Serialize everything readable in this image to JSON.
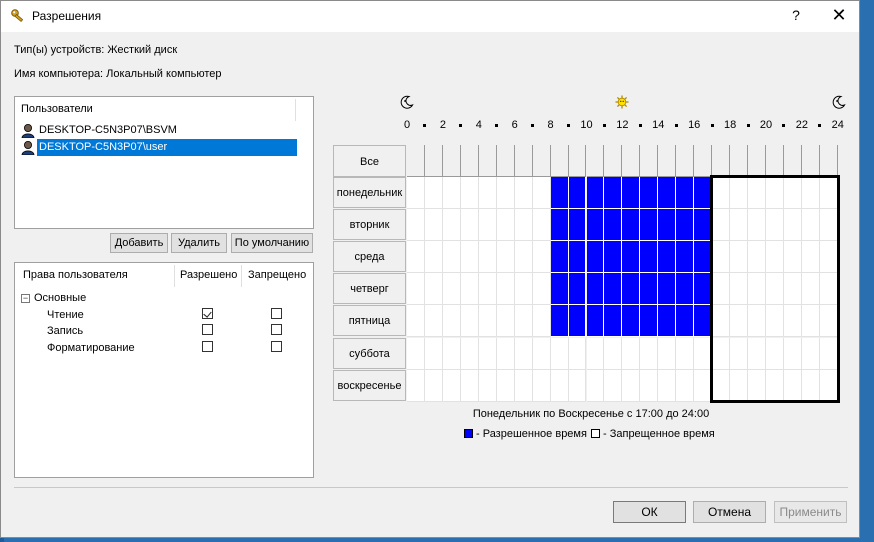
{
  "window": {
    "title": "Разрешения",
    "help": "?",
    "close": "✕"
  },
  "info": {
    "device_line": "Тип(ы) устройств: Жесткий диск",
    "computer_line": "Имя компьютера: Локальный компьютер"
  },
  "users": {
    "header": "Пользователи",
    "items": [
      {
        "name": "DESKTOP-C5N3P07\\BSVM",
        "selected": false
      },
      {
        "name": "DESKTOP-C5N3P07\\user",
        "selected": true
      }
    ]
  },
  "user_buttons": {
    "add": "Добавить",
    "delete": "Удалить",
    "default": "По умолчанию"
  },
  "permissions": {
    "col_rights": "Права пользователя",
    "col_allowed": "Разрешено",
    "col_denied": "Запрещено",
    "group": "Основные",
    "group_toggle": "−",
    "rows": [
      {
        "label": "Чтение",
        "allowed": true,
        "denied": false
      },
      {
        "label": "Запись",
        "allowed": false,
        "denied": false
      },
      {
        "label": "Форматирование",
        "allowed": false,
        "denied": false
      }
    ]
  },
  "schedule": {
    "hour_labels": [
      "0",
      "2",
      "4",
      "6",
      "8",
      "10",
      "12",
      "14",
      "16",
      "18",
      "20",
      "22",
      "24"
    ],
    "all_label": "Все",
    "days": [
      "понедельник",
      "вторник",
      "среда",
      "четверг",
      "пятница",
      "суббота",
      "воскресенье"
    ],
    "allowed": [
      [
        8,
        17
      ],
      [
        8,
        17
      ],
      [
        8,
        17
      ],
      [
        8,
        17
      ],
      [
        8,
        17
      ],
      [],
      []
    ],
    "selection": {
      "from_day": 0,
      "to_day": 6,
      "from_hour": 17,
      "to_hour": 24
    },
    "summary": "Понедельник по Воскресенье с 17:00 до 24:00",
    "legend_allowed": "- Разрешенное время",
    "legend_denied": "- Запрещенное время",
    "allowed_color": "#0000ff",
    "denied_color": "#ffffff"
  },
  "footer": {
    "ok": "ОК",
    "cancel": "Отмена",
    "apply": "Применить"
  }
}
